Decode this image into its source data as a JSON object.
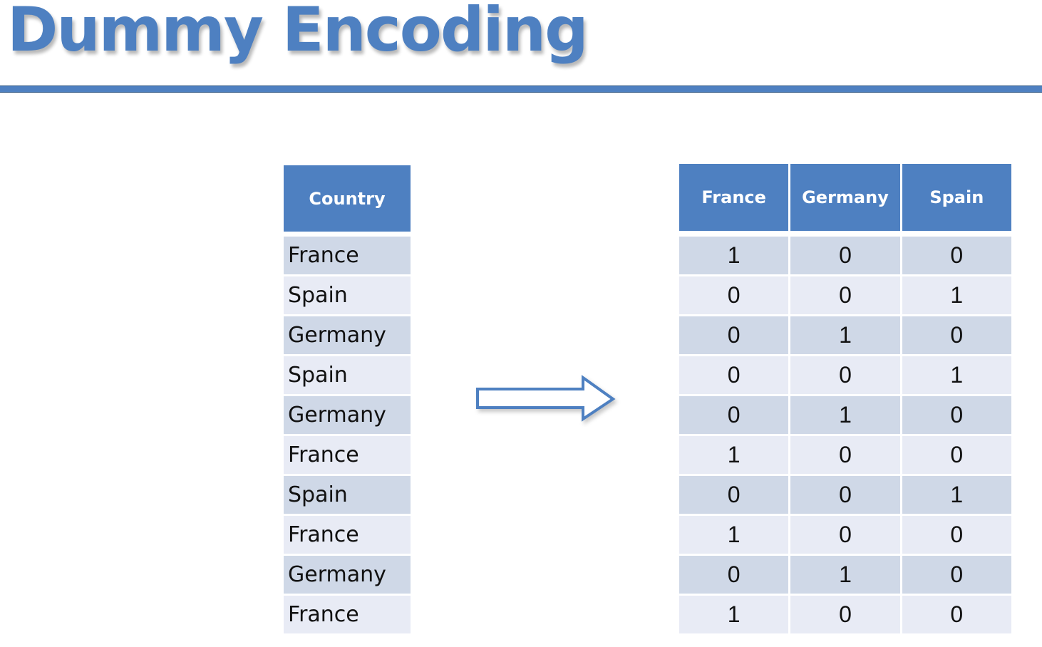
{
  "slide": {
    "title": "Dummy Encoding",
    "accent_color": "#4e80c1"
  },
  "country_table": {
    "header": "Country",
    "rows": [
      "France",
      "Spain",
      "Germany",
      "Spain",
      "Germany",
      "France",
      "Spain",
      "France",
      "Germany",
      "France"
    ]
  },
  "arrow": {
    "icon": "right-arrow-icon",
    "direction": "right"
  },
  "dummy_table": {
    "headers": [
      "France",
      "Germany",
      "Spain"
    ],
    "rows": [
      [
        "1",
        "0",
        "0"
      ],
      [
        "0",
        "0",
        "1"
      ],
      [
        "0",
        "1",
        "0"
      ],
      [
        "0",
        "0",
        "1"
      ],
      [
        "0",
        "1",
        "0"
      ],
      [
        "1",
        "0",
        "0"
      ],
      [
        "0",
        "0",
        "1"
      ],
      [
        "1",
        "0",
        "0"
      ],
      [
        "0",
        "1",
        "0"
      ],
      [
        "1",
        "0",
        "0"
      ]
    ]
  }
}
